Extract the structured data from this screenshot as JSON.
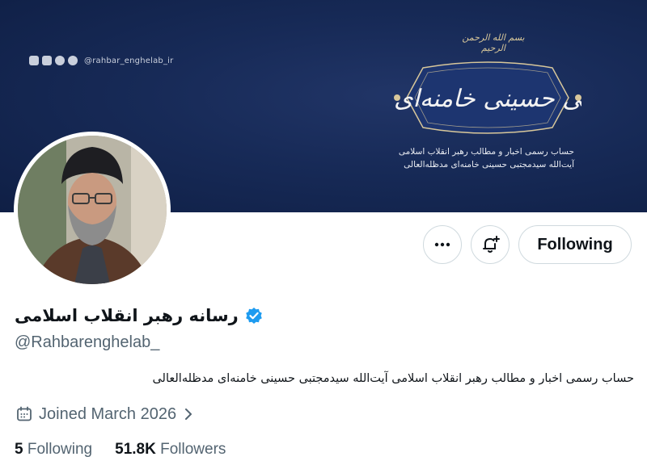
{
  "banner": {
    "social_handle": "@rahbar_enghelab_ir",
    "bismillah": "بسم الله الرحمن الرحیم",
    "calligraphy": "حضرت آیت الله سید مجتبی حسینی خامنه‌ای",
    "description_line1": "حساب رسمی اخبار و مطالب رهبر انقلاب اسلامی",
    "description_line2": "آیت‌الله سیدمجتبی حسینی خامنه‌ای مدظله‌العالی",
    "colors": {
      "background": "#172a57",
      "gold": "#d8c79a"
    }
  },
  "profile": {
    "display_name": "رسانه رهبر انقلاب اسلامی",
    "handle": "@Rahbarenghelab_",
    "verified": true,
    "bio": "حساب رسمی اخبار و مطالب رهبر انقلاب اسلامی آیت‌الله سیدمجتبی حسینی خامنه‌ای مدظله‌العالی",
    "joined": "Joined March 2026",
    "following_count": "5",
    "following_label": "Following",
    "followers_count": "51.8K",
    "followers_label": "Followers"
  },
  "actions": {
    "following_button_label": "Following",
    "more_icon": "more-horizontal-icon",
    "notify_icon": "bell-plus-icon"
  },
  "colors": {
    "verified_blue": "#1d9bf0",
    "secondary_text": "#536471",
    "primary_text": "#0f1419",
    "border": "#cfd9de"
  }
}
